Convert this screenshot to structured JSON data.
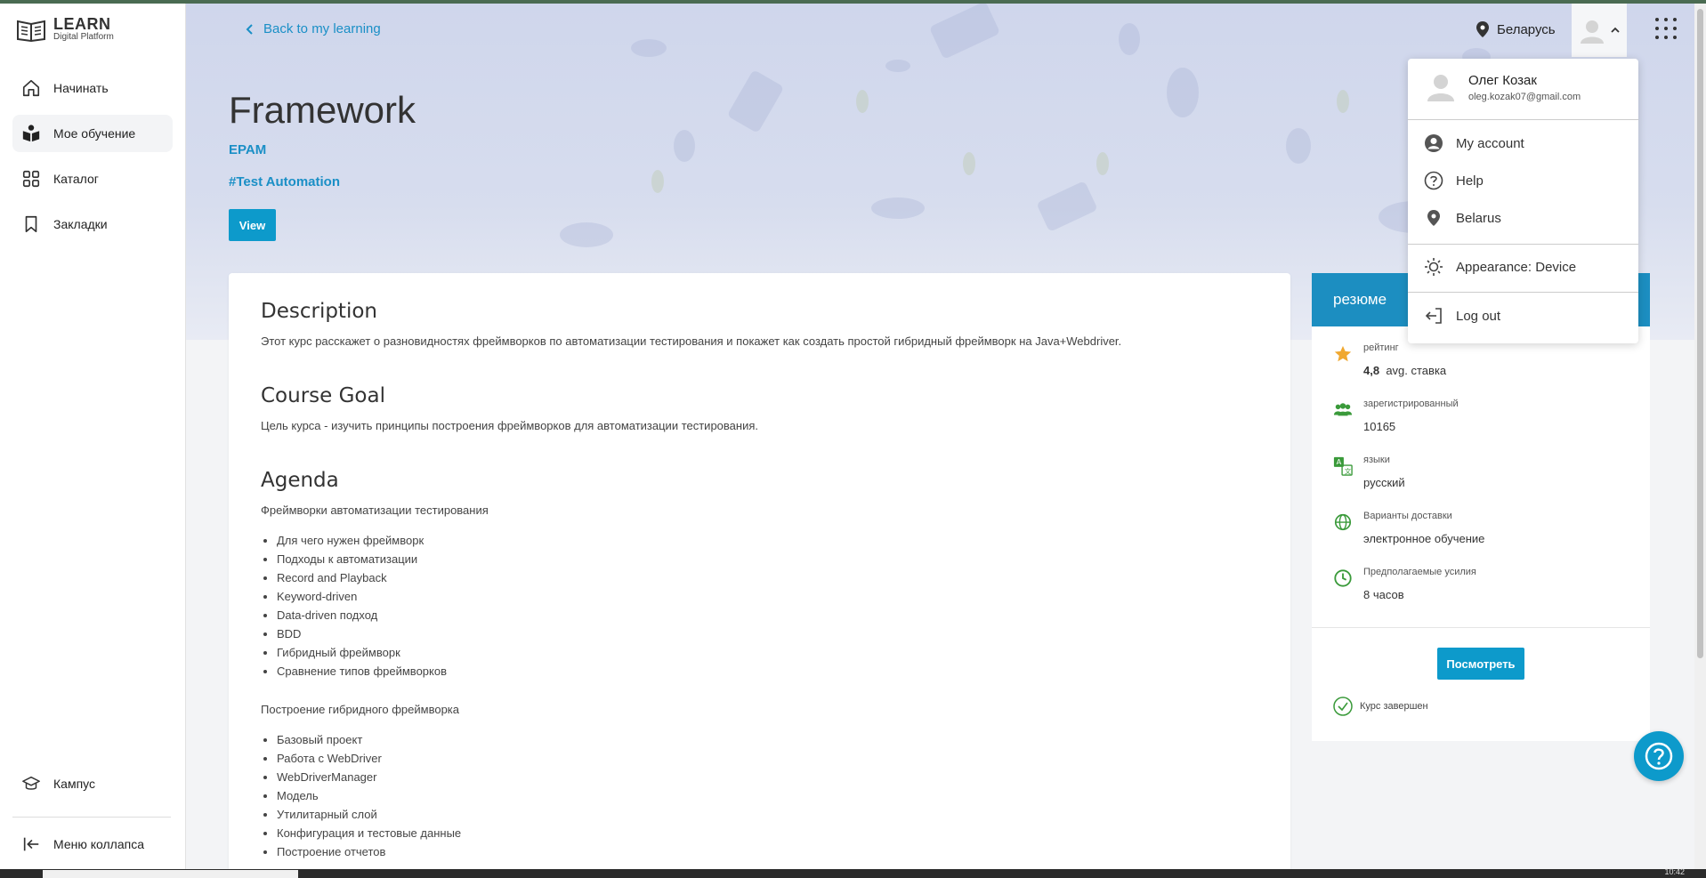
{
  "logo": {
    "line1": "LEARN",
    "line2": "Digital Platform"
  },
  "sidebar": {
    "items": [
      {
        "label": "Начинать",
        "icon": "home-icon"
      },
      {
        "label": "Мое обучение",
        "icon": "learning-icon",
        "active": true
      },
      {
        "label": "Каталог",
        "icon": "grid-icon"
      },
      {
        "label": "Закладки",
        "icon": "bookmark-icon"
      }
    ],
    "bottom": [
      {
        "label": "Кампус",
        "icon": "campus-icon"
      },
      {
        "label": "Меню коллапса",
        "icon": "collapse-icon"
      }
    ]
  },
  "header": {
    "back_label": "Back to my learning",
    "region": "Беларусь"
  },
  "course": {
    "title": "Framework",
    "provider": "EPAM",
    "tag": "#Test Automation",
    "view_label": "View"
  },
  "content": {
    "description_title": "Description",
    "description_text": "Этот курс расскажет о разновидностях фреймворков по автоматизации тестирования и покажет как создать простой гибридный фреймворк на Java+Webdriver.",
    "goal_title": "Course Goal",
    "goal_text": "Цель курса - изучить принципы построения фреймворков для автоматизации тестирования.",
    "agenda_title": "Agenda",
    "agenda_section1": "Фреймворки автоматизации тестирования",
    "agenda_list1": [
      "Для чего нужен фреймворк",
      "Подходы к автоматизации",
      "Record and Playback",
      "Keyword-driven",
      "Data-driven подход",
      "BDD",
      "Гибридный фреймворк",
      "Сравнение типов фреймворков"
    ],
    "agenda_section2": "Построение гибридного фреймворка",
    "agenda_list2": [
      "Базовый проект",
      "Работа с WebDriver",
      "WebDriverManager",
      "Модель",
      "Утилитарный слой",
      "Конфигурация и тестовые данные",
      "Построение отчетов"
    ]
  },
  "summary": {
    "title": "резюме",
    "rating_label": "рейтинг",
    "rating_value": "4,8",
    "rating_suffix": "avg. ставка",
    "registered_label": "зарегистрированный",
    "registered_value": "10165",
    "languages_label": "языки",
    "languages_value": "русский",
    "delivery_label": "Варианты доставки",
    "delivery_value": "электронное обучение",
    "effort_label": "Предполагаемые усилия",
    "effort_value": "8 часов",
    "watch_label": "Посмотреть",
    "completed_label": "Курс завершен"
  },
  "dropdown": {
    "user_name": "Олег Козак",
    "user_email": "oleg.kozak07@gmail.com",
    "items": [
      {
        "label": "My account",
        "icon": "account-icon"
      },
      {
        "label": "Help",
        "icon": "help-circle-icon"
      },
      {
        "label": "Belarus",
        "icon": "location-icon"
      },
      {
        "label": "Appearance: Device",
        "icon": "sun-icon"
      },
      {
        "label": "Log out",
        "icon": "logout-icon"
      }
    ]
  },
  "taskbar": {
    "time": "10:42"
  },
  "colors": {
    "accent": "#0d9acb",
    "link": "#1a8fc6",
    "summary_header": "#1c8ec1",
    "green": "#3a9a3a"
  }
}
